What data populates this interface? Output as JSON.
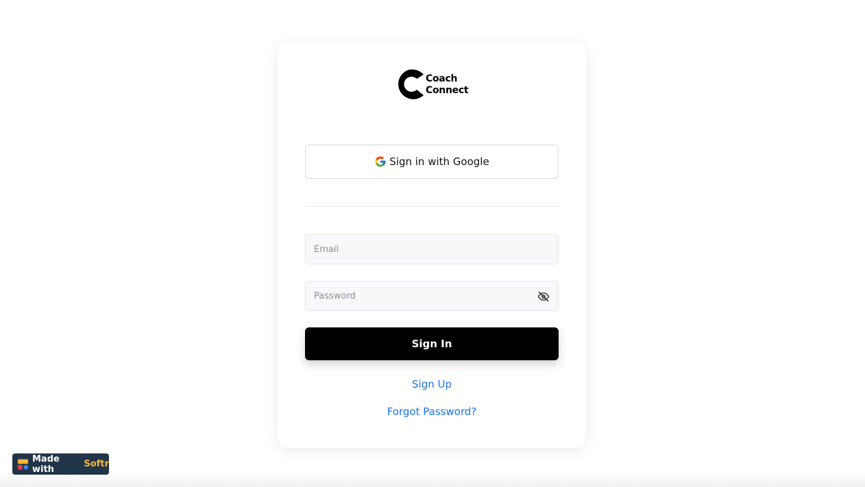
{
  "logo": {
    "line1": "Coach",
    "line2": "Connect"
  },
  "google_button": {
    "label": "Sign in with Google",
    "icon": "google-icon"
  },
  "email_field": {
    "placeholder": "Email",
    "value": ""
  },
  "password_field": {
    "placeholder": "Password",
    "value": "",
    "toggle_icon": "eye-off-icon"
  },
  "signin_button": {
    "label": "Sign In"
  },
  "links": {
    "signup": "Sign Up",
    "forgot_password": "Forgot Password?"
  },
  "badge": {
    "prefix": "Made with",
    "brand": "Softr"
  },
  "colors": {
    "link": "#1a73e8",
    "primary_button": "#000000",
    "badge_bg": "#213549",
    "badge_brand": "#f9b82e"
  }
}
